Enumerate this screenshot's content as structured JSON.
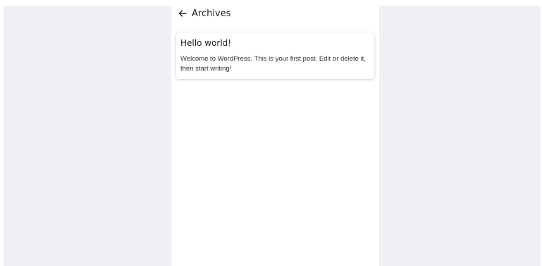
{
  "header": {
    "back_icon": "arrow-left-icon",
    "title": "Archives"
  },
  "posts": [
    {
      "title": "Hello world!",
      "excerpt": "Welcome to WordPress. This is your first post. Edit or delete it, then start writing!"
    }
  ],
  "colors": {
    "side_background": "#efeff4",
    "panel_background": "#ffffff",
    "text": "#1f1f1f"
  }
}
